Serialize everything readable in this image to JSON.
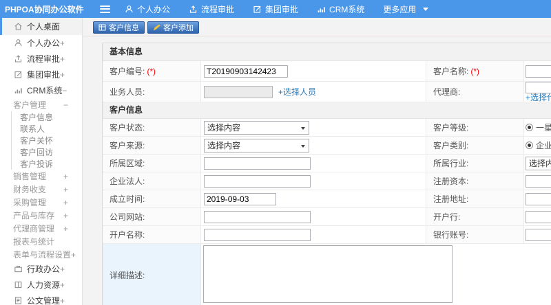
{
  "topbar": {
    "logo": "PHPOA协同办公软件",
    "items": [
      {
        "label": "个人办公"
      },
      {
        "label": "流程审批"
      },
      {
        "label": "集团审批"
      },
      {
        "label": "CRM系统"
      },
      {
        "label": "更多应用"
      }
    ]
  },
  "sidebar": {
    "items": [
      {
        "label": "个人桌面",
        "marker": ""
      },
      {
        "label": "个人办公",
        "marker": "+"
      },
      {
        "label": "流程审批",
        "marker": "+"
      },
      {
        "label": "集团审批",
        "marker": "+"
      },
      {
        "label": "CRM系统",
        "marker": "−"
      },
      {
        "label": "客户管理",
        "marker": "−"
      },
      {
        "label": "客户信息",
        "marker": ""
      },
      {
        "label": "联系人",
        "marker": ""
      },
      {
        "label": "客户关怀",
        "marker": ""
      },
      {
        "label": "客户回访",
        "marker": ""
      },
      {
        "label": "客户投诉",
        "marker": ""
      },
      {
        "label": "销售管理",
        "marker": "+"
      },
      {
        "label": "财务收支",
        "marker": "+"
      },
      {
        "label": "采购管理",
        "marker": "+"
      },
      {
        "label": "产品与库存",
        "marker": "+"
      },
      {
        "label": "代理商管理",
        "marker": "+"
      },
      {
        "label": "报表与统计",
        "marker": ""
      },
      {
        "label": "表单与流程设置",
        "marker": "+"
      },
      {
        "label": "行政办公",
        "marker": "+"
      },
      {
        "label": "人力资源",
        "marker": "+"
      },
      {
        "label": "公文管理",
        "marker": "+"
      }
    ]
  },
  "tabs": [
    {
      "label": "客户信息"
    },
    {
      "label": "客户添加"
    }
  ],
  "form": {
    "sections": {
      "basic": "基本信息",
      "customer": "客户信息"
    },
    "fields": {
      "customer_no": {
        "label": "客户编号:",
        "required": "(*)",
        "value": "T20190903142423"
      },
      "customer_name": {
        "label": "客户名称:",
        "required": "(*)",
        "value": ""
      },
      "sales_person": {
        "label": "业务人员:",
        "value": "",
        "link": "+选择人员"
      },
      "agent": {
        "label": "代理商:",
        "value": "",
        "link": "+选择代理商"
      },
      "status": {
        "label": "客户状态:",
        "value": "选择内容"
      },
      "grade": {
        "label": "客户等级:",
        "option1": "一星"
      },
      "source": {
        "label": "客户来源:",
        "value": "选择内容"
      },
      "category": {
        "label": "客户类别:",
        "option1": "企业客户"
      },
      "region": {
        "label": "所属区域:",
        "value": ""
      },
      "industry": {
        "label": "所属行业:",
        "value": "选择内容"
      },
      "legal_person": {
        "label": "企业法人:",
        "value": ""
      },
      "registered_capital": {
        "label": "注册资本:",
        "value": ""
      },
      "founded_date": {
        "label": "成立时间:",
        "value": "2019-09-03"
      },
      "registered_address": {
        "label": "注册地址:",
        "value": ""
      },
      "website": {
        "label": "公司网站:",
        "value": ""
      },
      "bank": {
        "label": "开户行:",
        "value": ""
      },
      "account_name": {
        "label": "开户名称:",
        "value": ""
      },
      "bank_account": {
        "label": "银行账号:",
        "value": ""
      },
      "description": {
        "label": "详细描述:",
        "value": ""
      }
    }
  },
  "colors": {
    "topbar_blue": "#4a96e8",
    "tab_gradient_top": "#6aa0dd",
    "tab_gradient_bottom": "#2f64ad",
    "link_blue": "#2a7ab9",
    "required_red": "#ff0000",
    "desc_cell_blue": "#e9f4fd"
  }
}
